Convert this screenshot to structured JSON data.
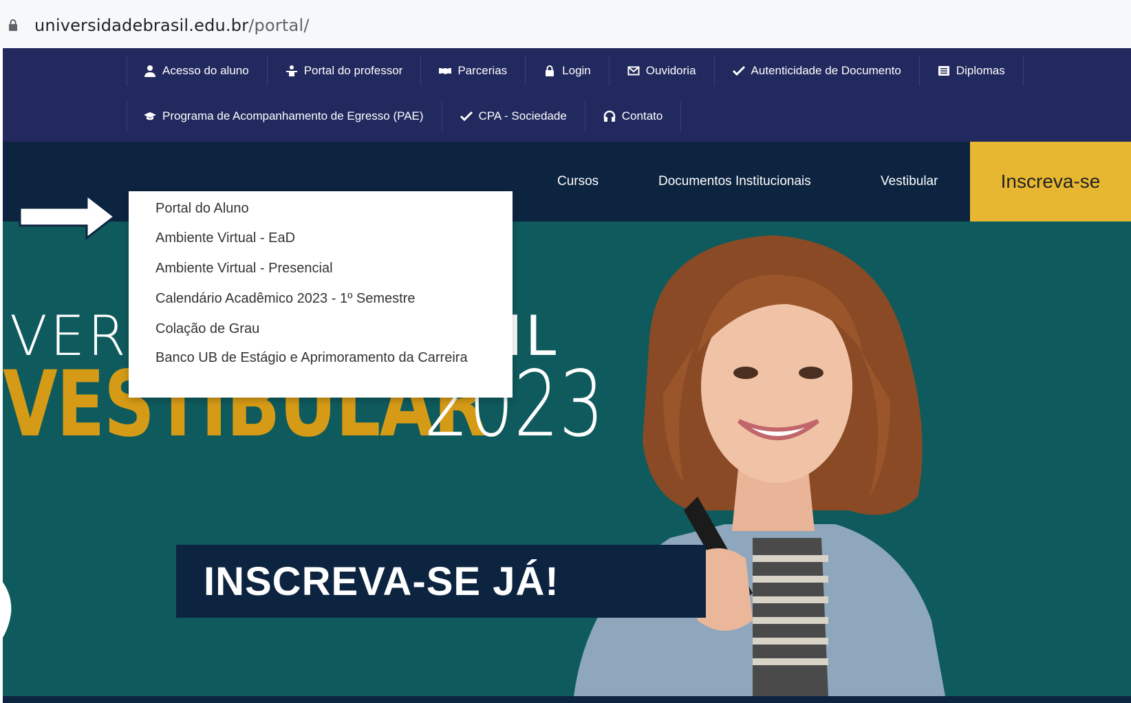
{
  "browser": {
    "url_domain": "universidadebrasil.edu.br",
    "url_path": "/portal/"
  },
  "topbar": {
    "row1": [
      {
        "label": "Acesso do aluno",
        "icon": "user-icon"
      },
      {
        "label": "Portal do professor",
        "icon": "teacher-icon"
      },
      {
        "label": "Parcerias",
        "icon": "handshake-icon"
      },
      {
        "label": "Login",
        "icon": "lock-icon"
      },
      {
        "label": "Ouvidoria",
        "icon": "envelope-icon"
      },
      {
        "label": "Autenticidade de Documento",
        "icon": "check-icon"
      },
      {
        "label": "Diplomas",
        "icon": "list-icon"
      }
    ],
    "row2": [
      {
        "label": "Programa de Acompanhamento de Egresso (PAE)",
        "icon": "graduation-cap-icon"
      },
      {
        "label": "CPA - Sociedade",
        "icon": "check-icon"
      },
      {
        "label": "Contato",
        "icon": "headphones-icon"
      }
    ]
  },
  "mainnav": {
    "cursos": "Cursos",
    "documentos": "Documentos Institucionais",
    "vestibular": "Vestibular",
    "cta": "Inscreva-se"
  },
  "dropdown": {
    "items": [
      "Portal do Aluno",
      "Ambiente Virtual - EaD",
      "Ambiente Virtual - Presencial",
      "Calendário Acadêmico 2023 - 1º Semestre",
      "Colação de Grau",
      "Banco UB de Estágio e Aprimoramento da Carreira"
    ]
  },
  "hero": {
    "line1_left": "VER",
    "line1_right": "IL",
    "vestibular": "VESTIBULAR",
    "year": "2023",
    "band": "INSCREVA-SE JÁ!"
  },
  "colors": {
    "topbar": "#22295e",
    "mainnav": "#0d2440",
    "cta": "#e8b732",
    "hero": "#0f5a5d",
    "vestibular": "#d69b16"
  }
}
